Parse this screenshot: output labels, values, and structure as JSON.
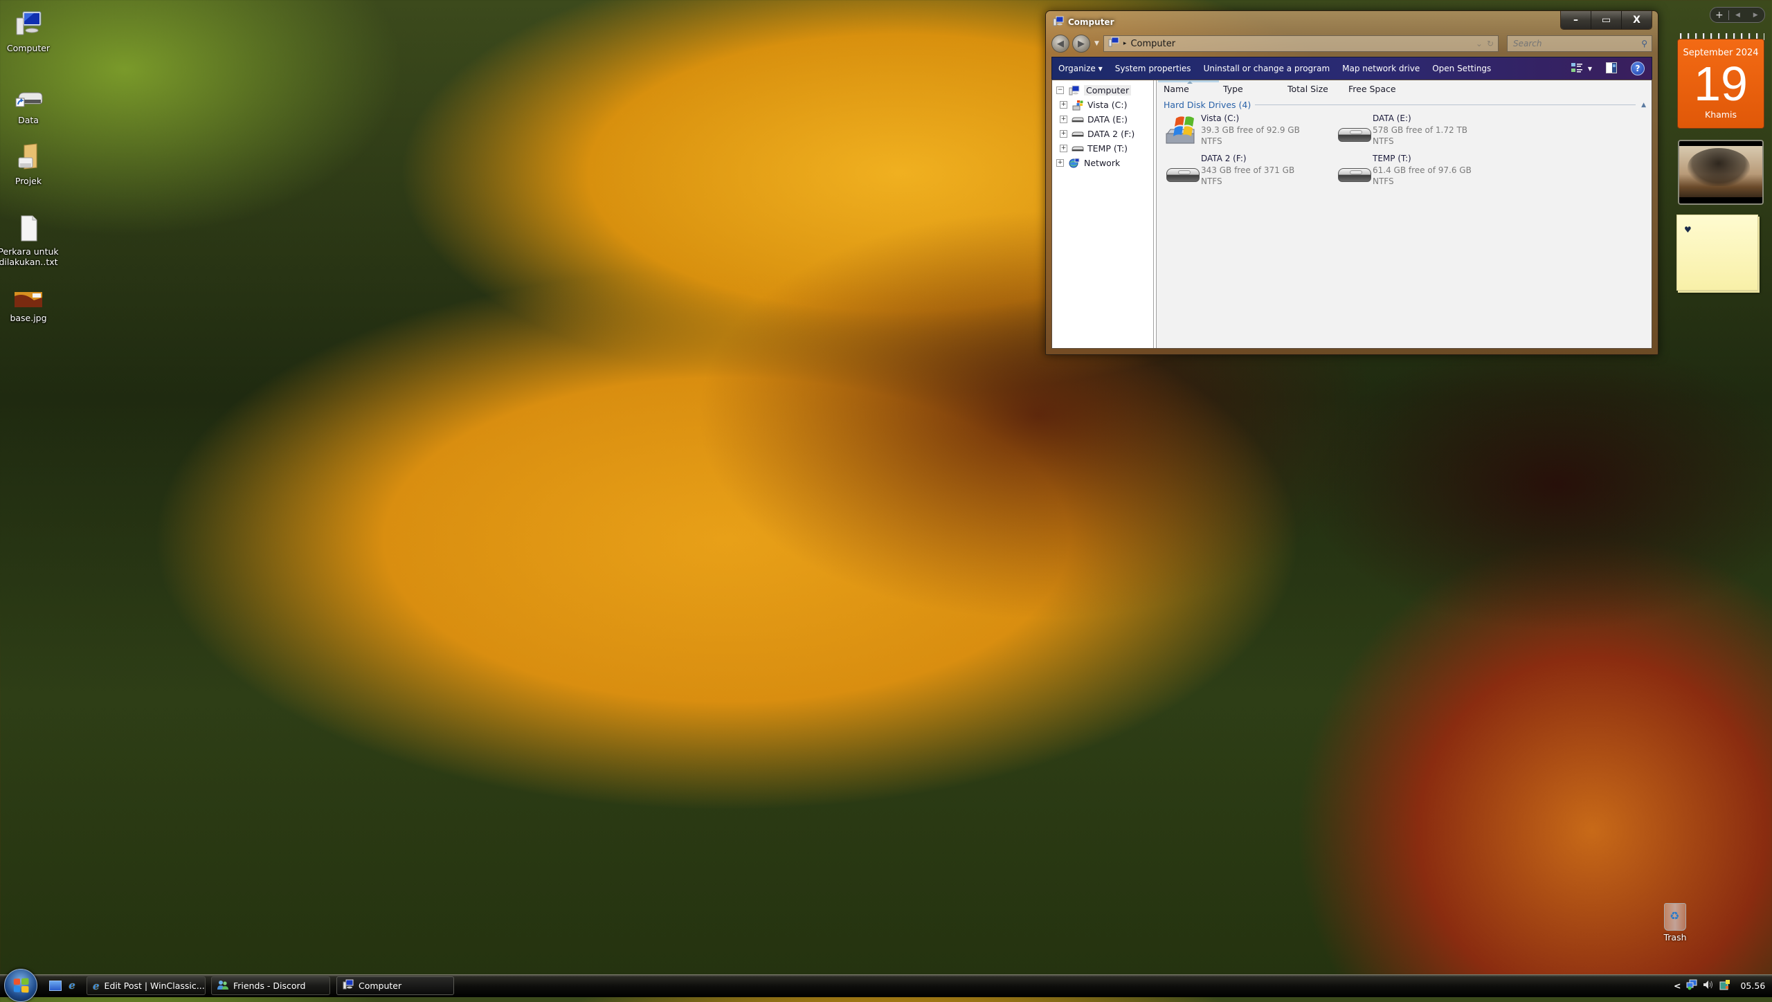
{
  "desktop": {
    "icons": [
      {
        "label": "Computer",
        "icon": "computer-icon"
      },
      {
        "label": "Data",
        "icon": "drive-shortcut-icon"
      },
      {
        "label": "Projek",
        "icon": "folder-icon"
      },
      {
        "label": "Perkara untuk dilakukan..txt",
        "icon": "text-file-icon"
      },
      {
        "label": "base.jpg",
        "icon": "image-file-icon"
      }
    ],
    "trash": {
      "label": "Trash",
      "icon": "recycle-bin-icon"
    }
  },
  "window": {
    "title": "Computer",
    "address": {
      "crumb": "Computer",
      "separator": "▸"
    },
    "search": {
      "placeholder": "Search"
    },
    "captions": {
      "minimize": "–",
      "maximize": "▭",
      "close": "X"
    },
    "commands": [
      {
        "label": "Organize",
        "has_dropdown": true
      },
      {
        "label": "System properties"
      },
      {
        "label": "Uninstall or change a program"
      },
      {
        "label": "Map network drive"
      },
      {
        "label": "Open Settings"
      }
    ],
    "tools": {
      "views": "views-icon",
      "preview": "preview-pane-icon",
      "help": "?"
    },
    "nav_tree": [
      {
        "label": "Computer",
        "expander": "⊟",
        "icon": "computer-icon",
        "selected": true,
        "level": 0
      },
      {
        "label": "Vista (C:)",
        "expander": "⊞",
        "icon": "windows-drive-icon",
        "level": 1
      },
      {
        "label": "DATA (E:)",
        "expander": "⊞",
        "icon": "hard-drive-icon",
        "level": 1
      },
      {
        "label": "DATA 2 (F:)",
        "expander": "⊞",
        "icon": "hard-drive-icon",
        "level": 1
      },
      {
        "label": "TEMP (T:)",
        "expander": "⊞",
        "icon": "hard-drive-icon",
        "level": 1
      },
      {
        "label": "Network",
        "expander": "⊞",
        "icon": "network-icon",
        "level": 0
      }
    ],
    "columns": [
      "Name",
      "Type",
      "Total Size",
      "Free Space"
    ],
    "group": {
      "label": "Hard Disk Drives (4)",
      "collapse_glyph": "▲"
    },
    "drives": [
      {
        "name": "Vista (C:)",
        "space": "39.3 GB free of 92.9 GB",
        "fs": "NTFS",
        "icon": "windows-drive-icon"
      },
      {
        "name": "DATA (E:)",
        "space": "578 GB free of 1.72 TB",
        "fs": "NTFS",
        "icon": "hard-drive-icon"
      },
      {
        "name": "DATA 2 (F:)",
        "space": "343 GB free of 371 GB",
        "fs": "NTFS",
        "icon": "hard-drive-icon"
      },
      {
        "name": "TEMP (T:)",
        "space": "61.4 GB free of 97.6 GB",
        "fs": "NTFS",
        "icon": "hard-drive-icon"
      }
    ]
  },
  "gadgets": {
    "controls": {
      "add": "+",
      "prev": "◀",
      "next": "▶"
    },
    "calendar": {
      "month_year": "September 2024",
      "day": "19",
      "weekday": "Khamis",
      "color": "#ea6010"
    },
    "slideshow": {
      "icon": "tree-photo"
    },
    "notes": {
      "text": "♥",
      "color": "#fdf6b8"
    }
  },
  "taskbar": {
    "quick_launch": [
      {
        "name": "show-desktop-icon"
      },
      {
        "name": "internet-explorer-icon"
      }
    ],
    "buttons": [
      {
        "label": "Edit Post | WinClassic...",
        "icon": "internet-explorer-icon",
        "active": false
      },
      {
        "label": "Friends - Discord",
        "icon": "discord-icon",
        "active": false
      },
      {
        "label": "Computer",
        "icon": "computer-icon",
        "active": true
      }
    ],
    "tray": {
      "expand": "<",
      "clock": "05.56"
    }
  }
}
